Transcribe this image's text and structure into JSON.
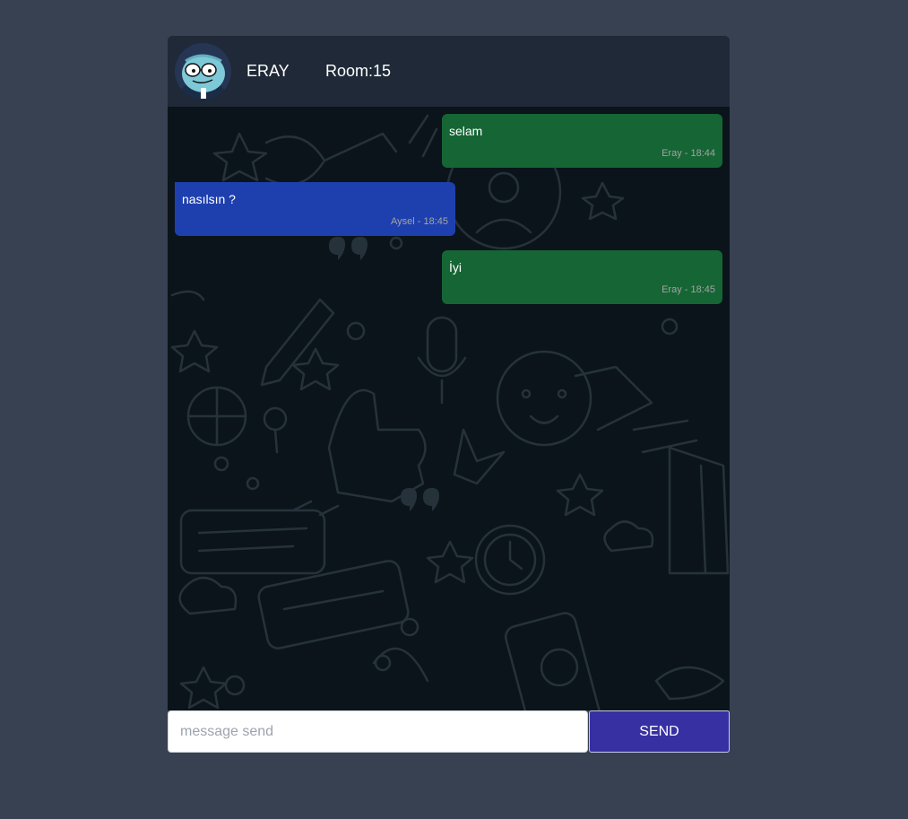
{
  "header": {
    "username": "ERAY",
    "room": "Room:15",
    "avatar_icon": "cartoon-character-avatar"
  },
  "messages": [
    {
      "text": "selam",
      "meta": "Eray - 18:44",
      "side": "sent"
    },
    {
      "text": "nasılsın ?",
      "meta": "Aysel - 18:45",
      "side": "received"
    },
    {
      "text": "İyi",
      "meta": "Eray - 18:45",
      "side": "sent"
    }
  ],
  "composer": {
    "placeholder": "message send",
    "value": "",
    "send_label": "SEND"
  },
  "colors": {
    "page_background": "#374151",
    "header_background": "#1f2937",
    "chat_background": "#0b141a",
    "sent_bubble": "#166534",
    "received_bubble": "#1e40af",
    "send_button": "#3730a3"
  }
}
